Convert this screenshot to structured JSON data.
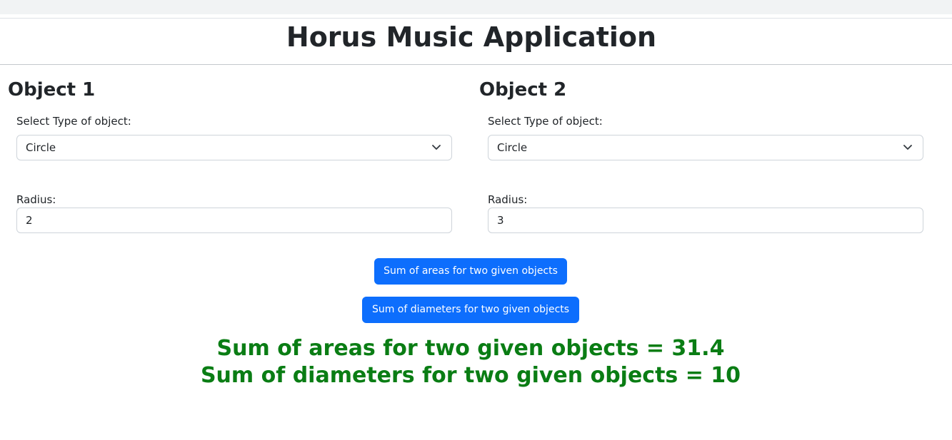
{
  "header": {
    "title": "Horus Music Application"
  },
  "object1": {
    "heading": "Object 1",
    "type_label": "Select Type of object:",
    "type_value": "Circle",
    "radius_label": "Radius:",
    "radius_value": "2"
  },
  "object2": {
    "heading": "Object 2",
    "type_label": "Select Type of object:",
    "type_value": "Circle",
    "radius_label": "Radius:",
    "radius_value": "3"
  },
  "actions": {
    "sum_areas_label": "Sum of areas for two given objects",
    "sum_diameters_label": "Sum of diameters for two given objects"
  },
  "results": {
    "areas_text": "Sum of areas for two given objects = 31.4",
    "diameters_text": "Sum of diameters for two given objects = 10"
  },
  "colors": {
    "primary_button": "#0d6efd",
    "result_text": "#0a7d14"
  },
  "icons": {
    "select_caret": "chevron-down-icon"
  }
}
